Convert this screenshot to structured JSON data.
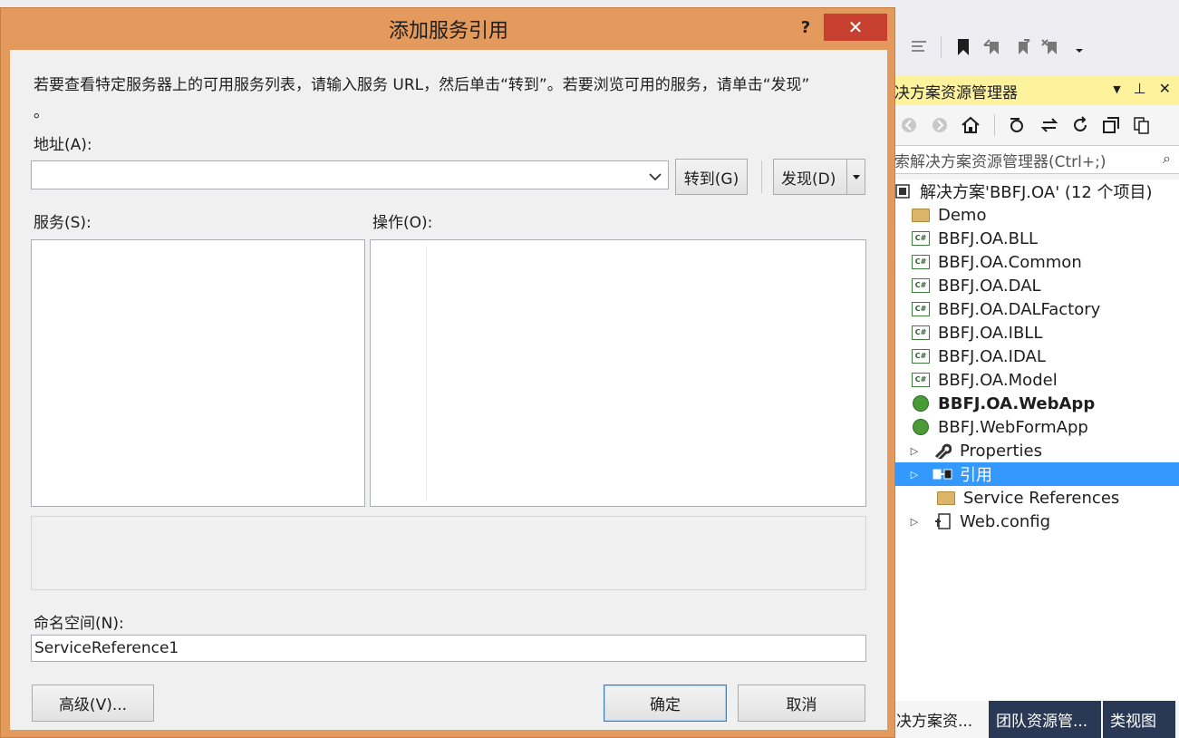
{
  "toolbar": {
    "icons": [
      "comment-out-icon",
      "bookmark-icon",
      "prev-bookmark-icon",
      "next-bookmark-icon",
      "clear-bookmark-icon",
      "overflow-icon"
    ]
  },
  "solution_explorer": {
    "title": "决方案资源管理器",
    "title_controls": {
      "dropdown": "▼",
      "pin": "⊥",
      "close": "✕"
    },
    "search_placeholder": "索解决方案资源管理器(Ctrl+;)",
    "search_button": "⌕",
    "tree": [
      {
        "label": "解决方案'BBFJ.OA' (12 个项目)",
        "icon": "solution-icon",
        "bold": false,
        "arrow": ""
      },
      {
        "label": "Demo",
        "icon": "folder-icon",
        "bold": false,
        "arrow": ""
      },
      {
        "label": "BBFJ.OA.BLL",
        "icon": "csharp-project-icon",
        "bold": false,
        "arrow": ""
      },
      {
        "label": "BBFJ.OA.Common",
        "icon": "csharp-project-icon",
        "bold": false,
        "arrow": ""
      },
      {
        "label": "BBFJ.OA.DAL",
        "icon": "csharp-project-icon",
        "bold": false,
        "arrow": ""
      },
      {
        "label": "BBFJ.OA.DALFactory",
        "icon": "csharp-project-icon",
        "bold": false,
        "arrow": ""
      },
      {
        "label": "BBFJ.OA.IBLL",
        "icon": "csharp-project-icon",
        "bold": false,
        "arrow": ""
      },
      {
        "label": "BBFJ.OA.IDAL",
        "icon": "csharp-project-icon",
        "bold": false,
        "arrow": ""
      },
      {
        "label": "BBFJ.OA.Model",
        "icon": "csharp-project-icon",
        "bold": false,
        "arrow": ""
      },
      {
        "label": "BBFJ.OA.WebApp",
        "icon": "web-project-icon",
        "bold": true,
        "arrow": ""
      },
      {
        "label": "BBFJ.WebFormApp",
        "icon": "web-project-icon",
        "bold": false,
        "arrow": ""
      },
      {
        "label": "Properties",
        "icon": "wrench-icon",
        "bold": false,
        "arrow": "▷"
      },
      {
        "label": "引用",
        "icon": "references-icon",
        "bold": false,
        "arrow": "▷",
        "selected": true
      },
      {
        "label": "Service References",
        "icon": "folder-icon",
        "bold": false,
        "arrow": ""
      },
      {
        "label": "Web.config",
        "icon": "config-file-icon",
        "bold": false,
        "arrow": "▷"
      }
    ],
    "tabs": [
      "决方案资...",
      "团队资源管...",
      "类视图"
    ]
  },
  "dialog": {
    "title": "添加服务引用",
    "help": "?",
    "close": "✕",
    "instructions_line1": "若要查看特定服务器上的可用服务列表，请输入服务 URL，然后单击“转到”。若要浏览可用的服务，请单击“发现”",
    "instructions_line2": "。",
    "address_label": "地址(A):",
    "address_value": "",
    "go_button": "转到(G)",
    "discover_button": "发现(D)",
    "services_label": "服务(S):",
    "operations_label": "操作(O):",
    "namespace_label": "命名空间(N):",
    "namespace_value": "ServiceReference1",
    "advanced_button": "高级(V)...",
    "ok_button": "确定",
    "cancel_button": "取消"
  }
}
